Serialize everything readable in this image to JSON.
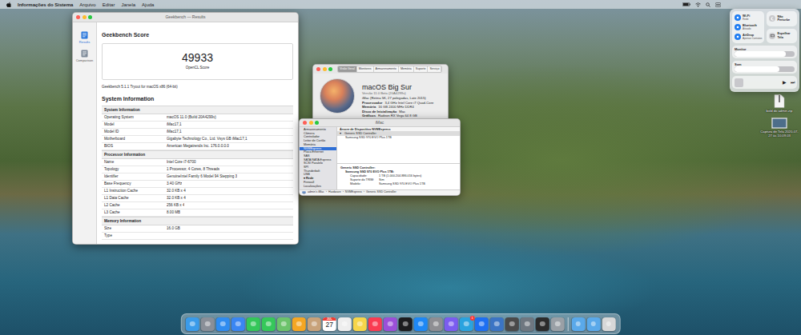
{
  "menubar": {
    "app": "Informações do Sistema",
    "menus": [
      "Arquivo",
      "Editar",
      "Janela",
      "Ajuda"
    ]
  },
  "geekbench": {
    "title": "Geekbench — Results",
    "sidebar": [
      {
        "label": "Results",
        "selected": true
      },
      {
        "label": "Comparison",
        "selected": false
      }
    ],
    "score_heading": "Geekbench Score",
    "score": "49933",
    "score_label": "OpenCL Score",
    "version": "Geekbench 5.1.1 Tryout for macOS x86 (64-bit)",
    "info_title": "System Information",
    "sections": [
      {
        "heading": "System Information",
        "rows": [
          [
            "Operating System",
            "macOS 11.0 (Build 20A4299v)"
          ],
          [
            "Model",
            "iMac17,1"
          ],
          [
            "Model ID",
            "iMac17,1"
          ],
          [
            "Motherboard",
            "Gigabyte Technology Co., Ltd. Vsys GB iMac17,1"
          ],
          [
            "BIOS",
            "American Megatrends Inc. 176.0.0.0.0"
          ]
        ]
      },
      {
        "heading": "Processor Information",
        "rows": [
          [
            "Name",
            "Intel Core i7-6700"
          ],
          [
            "Topology",
            "1 Processor, 4 Cores, 8 Threads"
          ],
          [
            "Identifier",
            "GenuineIntel Family 6 Model 94 Stepping 3"
          ],
          [
            "Base Frequency",
            "3.40 GHz"
          ],
          [
            "L1 Instruction Cache",
            "32.0 KB x 4"
          ],
          [
            "L1 Data Cache",
            "32.0 KB x 4"
          ],
          [
            "L2 Cache",
            "256 KB x 4"
          ],
          [
            "L3 Cache",
            "8.00 MB"
          ]
        ]
      },
      {
        "heading": "Memory Information",
        "rows": [
          [
            "Size",
            "16.0 GB"
          ],
          [
            "Type"
          ]
        ]
      }
    ]
  },
  "about": {
    "tabs": [
      {
        "label": "Visão Geral",
        "selected": true
      },
      {
        "label": "Monitores",
        "selected": false
      },
      {
        "label": "Armazenamento",
        "selected": false
      },
      {
        "label": "Memória",
        "selected": false
      },
      {
        "label": "Suporte",
        "selected": false
      },
      {
        "label": "Serviço",
        "selected": false
      }
    ],
    "os_name": "macOS",
    "os_release": "Big Sur",
    "version": "Versão 11.0 Beta (20A4299v)",
    "model": "iMac (Retina 5K, 27 polegadas, Late 2015)",
    "specs": [
      [
        "Processador",
        "3,4 GHz Intel Core i7 Quad-Core"
      ],
      [
        "Memória",
        "16 GB 2400 MHz DDR4"
      ],
      [
        "Disco de Inicialização",
        "Mac"
      ],
      [
        "Gráficos",
        "Radeon RX Vega 64 8 GB"
      ]
    ]
  },
  "sysinfo": {
    "title": "iMac",
    "sidebar": [
      {
        "label": "Armazenamento",
        "kind": "item",
        "selected": false
      },
      {
        "label": "Câmera",
        "kind": "item",
        "selected": false
      },
      {
        "label": "Controlador",
        "kind": "item",
        "selected": false
      },
      {
        "label": "Leitor de Cartão",
        "kind": "item",
        "selected": false
      },
      {
        "label": "Memória",
        "kind": "item",
        "selected": false
      },
      {
        "label": "NVMExpress",
        "kind": "item",
        "selected": true
      },
      {
        "label": "Placa Ethernet",
        "kind": "item",
        "selected": false
      },
      {
        "label": "SAS",
        "kind": "item",
        "selected": false
      },
      {
        "label": "SATA/SATA Express",
        "kind": "item",
        "selected": false
      },
      {
        "label": "SCSI Paralelo",
        "kind": "item",
        "selected": false
      },
      {
        "label": "SPI",
        "kind": "item",
        "selected": false
      },
      {
        "label": "Thunderbolt",
        "kind": "item",
        "selected": false
      },
      {
        "label": "USB",
        "kind": "item",
        "selected": false
      },
      {
        "label": "▾ Rede",
        "kind": "group",
        "selected": false
      },
      {
        "label": "Firewall",
        "kind": "item",
        "selected": false
      },
      {
        "label": "Localizações",
        "kind": "item",
        "selected": false
      }
    ],
    "tree_header": "Árvore de Dispositivo NVMExpress",
    "tree": [
      {
        "toggle": "▾",
        "label": "Generic SSD Controller",
        "kind": "parent",
        "selected": true
      },
      {
        "label": "Samsung SSD 970 EVO Plus 1TB",
        "kind": "child",
        "selected": false
      }
    ],
    "detail_heading": "Generic SSD Controller:",
    "detail_sub": "Samsung SSD 970 EVO Plus 1TB:",
    "detail_rows": [
      [
        "Capacidade:",
        "1 TB (1.000.204.886.016 bytes)"
      ],
      [
        "Suporte do TRIM:",
        "Sim"
      ],
      [
        "Modelo:",
        "Samsung SSD 970 EVO Plus 1TB"
      ]
    ],
    "path": [
      "admin's iMac",
      "Hardware",
      "NVMExpress",
      "Generic SSD Controller"
    ],
    "path_sep": "›"
  },
  "control_center": {
    "tiles": [
      {
        "title": "Wi-Fi",
        "subtitle": "Rede",
        "on": true
      },
      {
        "title": "Bluetooth",
        "subtitle": "Ativado",
        "on": true
      },
      {
        "title": "AirDrop",
        "subtitle": "Apenas Contatos",
        "on": true
      }
    ],
    "dnd": {
      "title": "Não Perturbe",
      "on": false
    },
    "mirror": {
      "title": "Espelhar Tela"
    },
    "sliders": [
      {
        "label": "Monitor",
        "level": 0.85
      },
      {
        "label": "Som",
        "level": 0.75
      }
    ],
    "media": {
      "play": "▶",
      "next": "⏭"
    }
  },
  "desktop_files": [
    {
      "label": "bold do admin.zip",
      "kind": "zip"
    },
    {
      "label": "Captura de Tela 2020-07-27 às 10.09.03",
      "kind": "image"
    }
  ],
  "dock": {
    "calendar_month": "JUL",
    "calendar_day": "27",
    "badge": "1"
  }
}
